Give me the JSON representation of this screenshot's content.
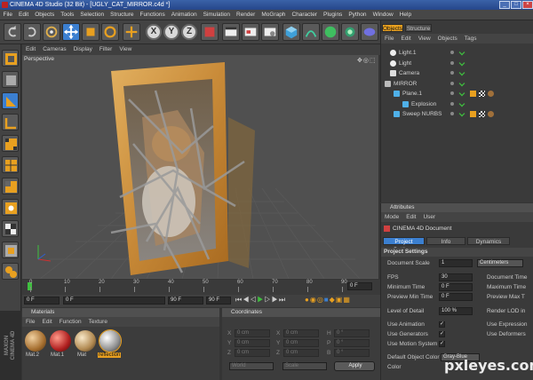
{
  "window": {
    "title": "CINEMA 4D Studio (32 Bit) - [UGLY_CAT_MIRROR.c4d *]"
  },
  "menu": [
    "File",
    "Edit",
    "Objects",
    "Tools",
    "Selection",
    "Structure",
    "Functions",
    "Animation",
    "Simulation",
    "Render",
    "MoGraph",
    "Character",
    "Plugins",
    "Python",
    "Window",
    "Help"
  ],
  "toolbar": {
    "axis_x": "X",
    "axis_y": "Y",
    "axis_z": "Z"
  },
  "viewport": {
    "menu": [
      "Edit",
      "Cameras",
      "Display",
      "Filter",
      "View"
    ],
    "label": "Perspective"
  },
  "timeline": {
    "ticks": [
      "0",
      "10",
      "20",
      "30",
      "40",
      "50",
      "60",
      "70",
      "80",
      "90"
    ],
    "end_field": "0 F"
  },
  "transport": {
    "start": "0 F",
    "current": "0 F",
    "end": "90 F",
    "end2": "90 F"
  },
  "objects": {
    "tabs": [
      "Objects",
      "Structure"
    ],
    "menu": [
      "File",
      "Edit",
      "View",
      "Objects",
      "Tags"
    ],
    "items": [
      {
        "name": "Light.1"
      },
      {
        "name": "Light"
      },
      {
        "name": "Camera"
      },
      {
        "name": "MIRROR"
      },
      {
        "name": "Plane.1"
      },
      {
        "name": "Explosion"
      },
      {
        "name": "Sweep NURBS"
      }
    ]
  },
  "attributes": {
    "title": "Attributes",
    "menu": [
      "Mode",
      "Edit",
      "User"
    ],
    "doc_title": "CINEMA 4D Document",
    "tabs": [
      "Project Settings",
      "Info",
      "Dynamics"
    ],
    "section": "Project Settings",
    "doc_scale_label": "Document Scale",
    "doc_scale_value": "1",
    "doc_scale_unit": "Centimeters",
    "fps_label": "FPS",
    "fps_value": "30",
    "doc_time_label": "Document Time",
    "min_time_label": "Minimum Time",
    "min_time_value": "0 F",
    "max_time_label": "Maximum Time",
    "prev_min_label": "Preview Min Time",
    "prev_min_value": "0 F",
    "prev_max_label": "Preview Max T",
    "lod_label": "Level of Detail",
    "lod_value": "100 %",
    "render_lod_label": "Render LOD in",
    "use_anim_label": "Use Animation",
    "use_expr_label": "Use Expression",
    "use_gen_label": "Use Generators",
    "use_deform_label": "Use Deformers",
    "use_motion_label": "Use Motion System",
    "default_color_label": "Default Object Color",
    "default_color_value": "Gray-Blue",
    "color_label": "Color"
  },
  "materials": {
    "title": "Materials",
    "menu": [
      "File",
      "Edit",
      "Function",
      "Texture"
    ],
    "items": [
      {
        "label": "Mat.2"
      },
      {
        "label": "Mat.1"
      },
      {
        "label": "Mat"
      },
      {
        "label": "reflection"
      }
    ]
  },
  "coordinates": {
    "title": "Coordinates",
    "rows": [
      {
        "a": "X",
        "av": "0 cm",
        "b": "X",
        "bv": "0 cm",
        "c": "H",
        "cv": "0 °"
      },
      {
        "a": "Y",
        "av": "0 cm",
        "b": "Y",
        "bv": "0 cm",
        "c": "P",
        "cv": "0 °"
      },
      {
        "a": "Z",
        "av": "0 cm",
        "b": "Z",
        "bv": "0 cm",
        "c": "B",
        "cv": "0 °"
      }
    ],
    "world": "World",
    "scale": "Scale",
    "apply": "Apply"
  },
  "side_label": {
    "line1": "MAXON",
    "line2": "CINEMA 4D"
  },
  "watermark": "pxleyes.com",
  "colors": {
    "accent": "#3b7fd0",
    "frame": "#d7a04a",
    "orange_tab": "#e8a020"
  }
}
